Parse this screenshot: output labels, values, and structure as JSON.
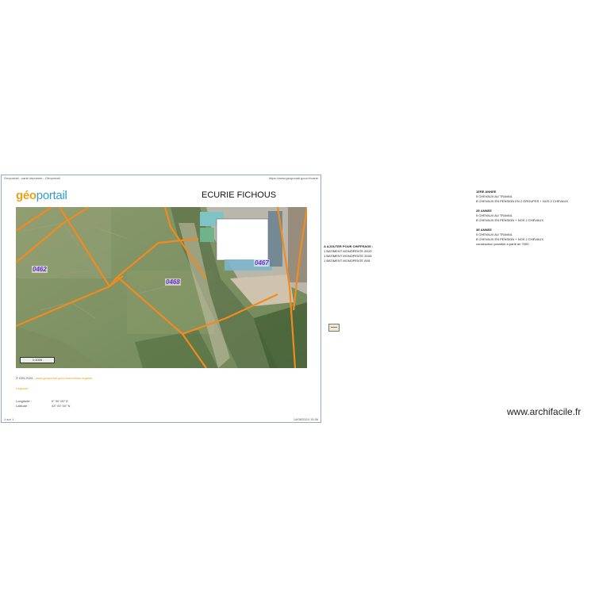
{
  "print_header": {
    "left": "Géoportail - carte imprimée - Géoportail",
    "right": "https://www.geoportail.gouv.fr/carte"
  },
  "print_footer": {
    "left": "1 sur 1",
    "right": "14/08/2024 15:36"
  },
  "logo": {
    "part1": "géo",
    "part2": "portail"
  },
  "map": {
    "title": "ECURIE FICHOUS",
    "parcels": [
      "0462",
      "0468",
      "0467"
    ],
    "scale_text": "1:1000"
  },
  "info": {
    "url_prefix": "© IGN 2024 - ",
    "url_link": "www.geoportail.gouv.fr/mentions-legales",
    "legend_label": "Légende",
    "longitude_label": "Longitude :",
    "longitude_value": "0° 00' 00\" E",
    "latitude_label": "Latitude :",
    "latitude_value": "43° 00' 00\" N"
  },
  "notes": {
    "add_header": "A AJOUTER POUR CHIFFRAGE :",
    "add_items": [
      "1 BATIMENT MONOPENTE 8X20",
      "1 BATIMENT MONOPENTE 20X8",
      "1 BATIMENT MONOPENTE 8X8"
    ],
    "year1_title": "1ERE ANNEE",
    "year1_items": [
      "5 CHEVAUX AU TRAVAIL",
      "8 CHEVAUX EN PENSION EN 2 GROUPES + NOS 2 CHEVAUX"
    ],
    "year2_title": "2E ANNEE",
    "year2_items": [
      "5 CHEVAUX AU TRAVAIL",
      "8 CHEVAUX EN PENSION + NOS 2 CHEVAUX"
    ],
    "year3_title": "3E ANNEE",
    "year3_items": [
      "5 CHEVAUX AU TRAVAIL",
      "8 CHEVAUX EN PENSION + NOS 2 CHEVAUX"
    ],
    "year3_extra": "construction possible a partir de 7000"
  },
  "watermark": "www.archifacile.fr",
  "colors": {
    "parcel_line": "#f28a1e",
    "parcel_label": "#6a2fd1",
    "logo_orange": "#e9a21c",
    "logo_blue": "#2e9fd3"
  }
}
